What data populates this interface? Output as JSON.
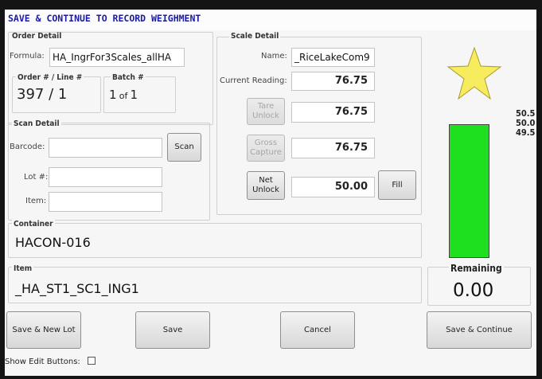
{
  "title": "SAVE & CONTINUE TO RECORD WEIGHMENT",
  "order_detail": {
    "group_label": "Order Detail",
    "formula_label": "Formula:",
    "formula_value": "HA_IngrFor3Scales_allHA",
    "order_line_label": "Order # / Line #",
    "order_line_value": "397 / 1",
    "batch_label": "Batch #",
    "batch_current": "1",
    "batch_of": "of",
    "batch_total": "1"
  },
  "scan_detail": {
    "group_label": "Scan Detail",
    "barcode_label": "Barcode:",
    "barcode_value": "",
    "scan_button": "Scan",
    "lot_label": "Lot #:",
    "lot_value": "",
    "item_label": "Item:",
    "item_value": ""
  },
  "scale_detail": {
    "group_label": "Scale Detail",
    "name_label": "Name:",
    "name_value": "_RiceLakeCom9",
    "current_reading_label": "Current Reading:",
    "current_reading_value": "76.75",
    "tare_button": "Tare\nUnlock",
    "tare_value": "76.75",
    "gross_button": "Gross\nCapture",
    "gross_value": "76.75",
    "net_button": "Net\nUnlock",
    "net_value": "50.00",
    "fill_button": "Fill"
  },
  "container": {
    "label": "Container",
    "value": "HACON-016"
  },
  "item": {
    "label": "Item",
    "value": "_HA_ST1_SC1_ING1"
  },
  "scale_graphic": {
    "star_icon": "star-icon",
    "star_color": "#f7ec5e",
    "bar_color": "#1ee01e",
    "tolerance_high": "50.5",
    "target": "50.0",
    "tolerance_low": "49.5"
  },
  "remaining": {
    "label": "Remaining",
    "value": "0.00"
  },
  "buttons": {
    "save_new_lot": "Save & New Lot",
    "save": "Save",
    "cancel": "Cancel",
    "save_continue": "Save & Continue"
  },
  "show_edit_buttons": {
    "label": "Show Edit Buttons:",
    "checked": false
  },
  "colors": {
    "title_text": "#1a1aa6",
    "background": "#f6f6f6"
  }
}
